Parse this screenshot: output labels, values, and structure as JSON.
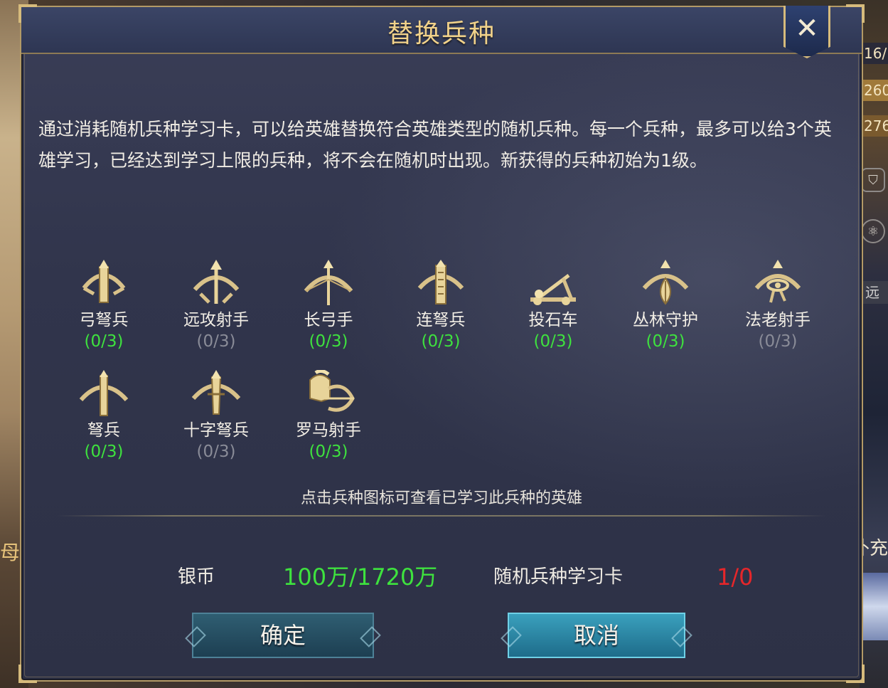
{
  "background": {
    "left_text": "母",
    "right_badges": [
      "16/",
      "260",
      "276"
    ],
    "right_tag": "远",
    "right_bottom_text": "补充"
  },
  "dialog": {
    "title": "替换兵种",
    "close_label": "✕",
    "description": "通过消耗随机兵种学习卡，可以给英雄替换符合英雄类型的随机兵种。每一个兵种，最多可以给3个英雄学习，已经达到学习上限的兵种，将不会在随机时出现。新获得的兵种初始为1级。",
    "units": [
      {
        "name": "弓弩兵",
        "count": "(0/3)",
        "available": true,
        "icon": "crossbow-icon"
      },
      {
        "name": "远攻射手",
        "count": "(0/3)",
        "available": false,
        "icon": "bow-arrow-icon"
      },
      {
        "name": "长弓手",
        "count": "(0/3)",
        "available": true,
        "icon": "longbow-icon"
      },
      {
        "name": "连弩兵",
        "count": "(0/3)",
        "available": true,
        "icon": "repeating-crossbow-icon"
      },
      {
        "name": "投石车",
        "count": "(0/3)",
        "available": true,
        "icon": "catapult-icon"
      },
      {
        "name": "丛林守护",
        "count": "(0/3)",
        "available": true,
        "icon": "forest-guard-icon"
      },
      {
        "name": "法老射手",
        "count": "(0/3)",
        "available": false,
        "icon": "pharaoh-archer-icon"
      },
      {
        "name": "弩兵",
        "count": "(0/3)",
        "available": true,
        "icon": "arbalest-icon"
      },
      {
        "name": "十字弩兵",
        "count": "(0/3)",
        "available": false,
        "icon": "cross-crossbow-icon"
      },
      {
        "name": "罗马射手",
        "count": "(0/3)",
        "available": true,
        "icon": "roman-archer-icon"
      }
    ],
    "hint": "点击兵种图标可查看已学习此兵种的英雄",
    "cost": {
      "silver_label": "银币",
      "silver_value": "100万/1720万",
      "card_label": "随机兵种学习卡",
      "card_value": "1/0"
    },
    "confirm_label": "确定",
    "cancel_label": "取消"
  }
}
